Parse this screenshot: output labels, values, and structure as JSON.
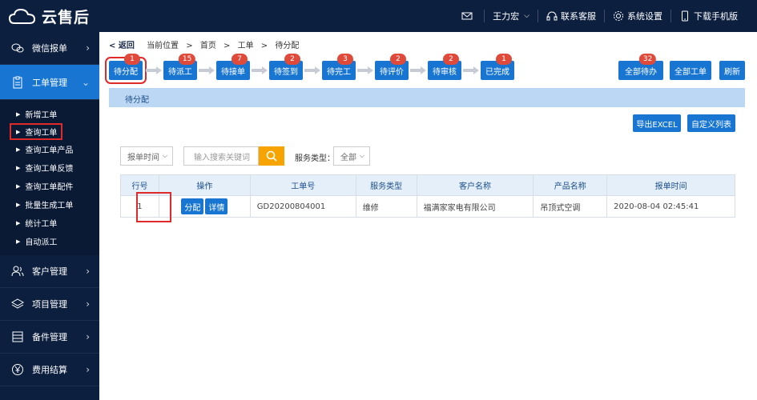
{
  "header": {
    "brand": "云售后",
    "user": "王力宏",
    "service": "联系客服",
    "settings": "系统设置",
    "download": "下载手机版"
  },
  "sidebar": {
    "items": [
      {
        "label": "微信报单",
        "icon": "wechat-icon"
      },
      {
        "label": "工单管理",
        "icon": "clipboard-icon",
        "active": true
      },
      {
        "label": "客户管理",
        "icon": "users-icon"
      },
      {
        "label": "项目管理",
        "icon": "layers-icon"
      },
      {
        "label": "备件管理",
        "icon": "list-icon"
      },
      {
        "label": "费用结算",
        "icon": "yen-icon"
      }
    ],
    "sub_items": [
      "新增工单",
      "查询工单",
      "查询工单产品",
      "查询工单反馈",
      "查询工单配件",
      "批量生成工单",
      "统计工单",
      "自动派工"
    ]
  },
  "breadcrumb": {
    "back": "< 返回",
    "prefix": "当前位置",
    "home": "首页",
    "section": "工单",
    "page": "待分配"
  },
  "steps": [
    {
      "label": "待分配",
      "count": "1"
    },
    {
      "label": "待派工",
      "count": "15"
    },
    {
      "label": "待接单",
      "count": "7"
    },
    {
      "label": "待签到",
      "count": "2"
    },
    {
      "label": "待完工",
      "count": "3"
    },
    {
      "label": "待评价",
      "count": "2"
    },
    {
      "label": "待审核",
      "count": "2"
    },
    {
      "label": "已完成",
      "count": "1"
    }
  ],
  "actions": {
    "all_pending": "全部待办",
    "all_pending_count": "32",
    "all_orders": "全部工单",
    "refresh": "刷新",
    "export": "导出EXCEL",
    "custom_columns": "自定义列表"
  },
  "tab": "待分配",
  "filters": {
    "time_select": "报单时间",
    "search_placeholder": "输入搜索关键词",
    "service_label": "服务类型：",
    "service_select": "全部"
  },
  "table": {
    "headers": [
      "行号",
      "操作",
      "工单号",
      "服务类型",
      "客户名称",
      "产品名称",
      "报单时间"
    ],
    "rows": [
      {
        "no": "1",
        "assign": "分配",
        "detail": "详情",
        "order_no": "GD20200804001",
        "service_type": "维修",
        "customer": "福满家家电有限公司",
        "product": "吊顶式空调",
        "time": "2020-08-04 02:45:41"
      }
    ]
  },
  "colors": {
    "navy": "#0c1f3f",
    "primary": "#1876d2",
    "badge": "#e04a3a",
    "highlight": "#e02a2a",
    "search": "#f8a400"
  }
}
